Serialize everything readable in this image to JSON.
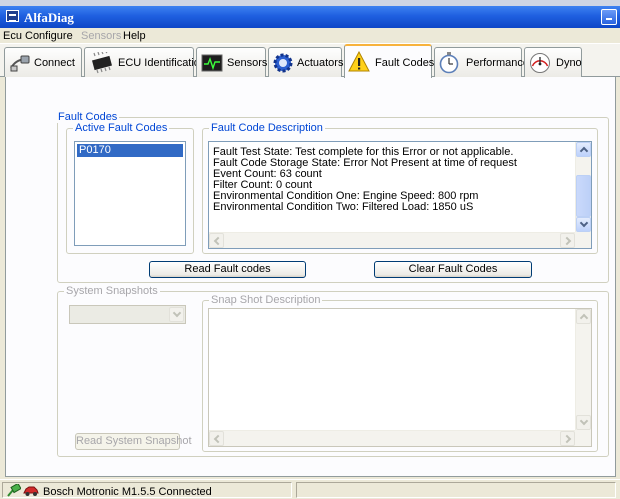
{
  "window": {
    "title": "AlfaDiag"
  },
  "menu": [
    {
      "label": "Ecu",
      "enabled": true
    },
    {
      "label": "Configure",
      "enabled": true
    },
    {
      "label": "Sensors",
      "enabled": false
    },
    {
      "label": "Help",
      "enabled": true
    }
  ],
  "tabs": [
    {
      "label": "Connect",
      "icon": "cable-plug-icon"
    },
    {
      "label": "ECU Identification",
      "icon": "chip-icon"
    },
    {
      "label": "Sensors",
      "icon": "oscilloscope-icon"
    },
    {
      "label": "Actuators",
      "icon": "gear-icon"
    },
    {
      "label": "Fault Codes",
      "icon": "warning-icon",
      "active": true
    },
    {
      "label": "Performance",
      "icon": "stopwatch-icon"
    },
    {
      "label": "Dyno",
      "icon": "gauge-icon"
    }
  ],
  "fault_codes": {
    "group_title": "Fault Codes",
    "active_title": "Active Fault Codes",
    "active_codes": [
      "P0170"
    ],
    "description_title": "Fault Code Description",
    "description_lines": [
      "Fault Test State: Test complete for this Error or not applicable.",
      "Fault Code Storage State: Error Not Present at time of request",
      "Event Count: 63 count",
      "Filter Count: 0 count",
      "Environmental Condition One: Engine Speed: 800 rpm",
      "Environmental Condition Two: Filtered Load: 1850 uS"
    ],
    "read_button": "Read Fault codes",
    "clear_button": "Clear Fault Codes"
  },
  "snapshots": {
    "group_title": "System Snapshots",
    "description_title": "Snap Shot Description",
    "selected_value": "",
    "read_button": "Read System Snapshot"
  },
  "status": {
    "text": "Bosch Motronic M1.5.5 Connected",
    "icons": [
      "connection-icon",
      "car-icon"
    ]
  },
  "colors": {
    "selection": "#316ac5",
    "group_title": "#0046d5",
    "active_tab_accent": "#f7b23c"
  }
}
